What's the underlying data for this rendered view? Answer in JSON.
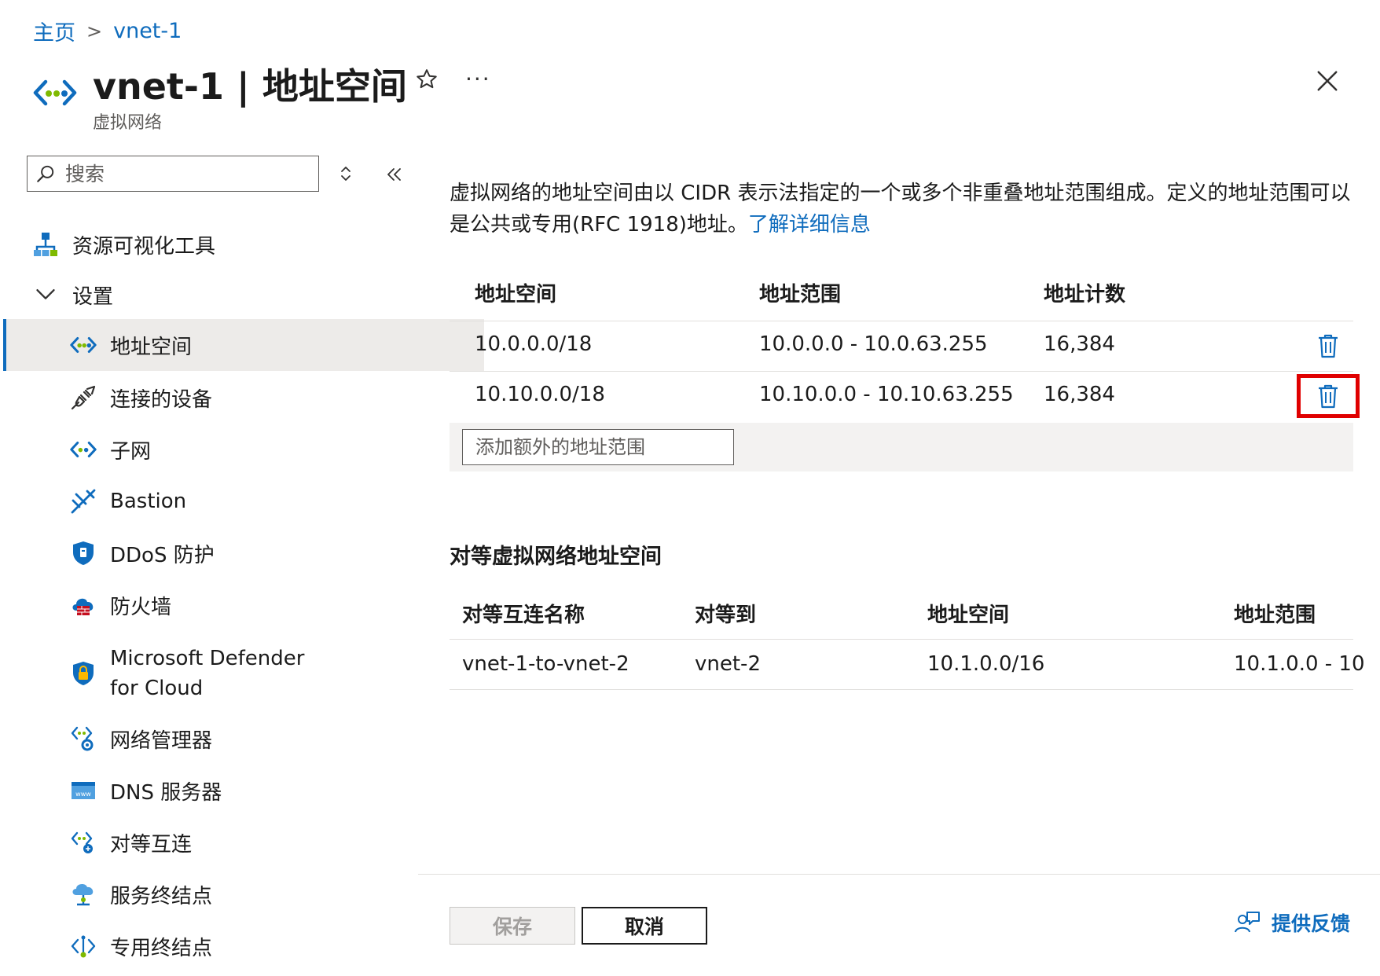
{
  "breadcrumb": {
    "home": "主页",
    "separator": ">",
    "current": "vnet-1"
  },
  "header": {
    "title": "vnet-1 | 地址空间",
    "subtitle": "虚拟网络",
    "more": "···"
  },
  "search": {
    "placeholder": "搜索"
  },
  "sidebar": {
    "items": [
      {
        "label": "资源可视化工具",
        "icon": "resource-visualizer-icon"
      },
      {
        "label": "设置",
        "icon": "chevron-down-icon"
      },
      {
        "label": "地址空间",
        "icon": "vnet-icon",
        "active": true
      },
      {
        "label": "连接的设备",
        "icon": "plug-icon"
      },
      {
        "label": "子网",
        "icon": "subnet-icon"
      },
      {
        "label": "Bastion",
        "icon": "bastion-icon"
      },
      {
        "label": "DDoS 防护",
        "icon": "ddos-shield-icon"
      },
      {
        "label_line1": "Microsoft Defender",
        "label_line2": "for Cloud",
        "icon": "defender-shield-icon"
      },
      {
        "label": "防火墙",
        "icon": "firewall-icon"
      },
      {
        "label": "网络管理器",
        "icon": "network-manager-icon"
      },
      {
        "label": "DNS 服务器",
        "icon": "dns-icon"
      },
      {
        "label": "对等互连",
        "icon": "peering-icon"
      },
      {
        "label": "服务终结点",
        "icon": "service-endpoint-icon"
      },
      {
        "label": "专用终结点",
        "icon": "private-endpoint-icon"
      }
    ]
  },
  "description": {
    "text": "虚拟网络的地址空间由以 CIDR 表示法指定的一个或多个非重叠地址范围组成。定义的地址范围可以是公共或专用(RFC 1918)地址。",
    "link": "了解详细信息"
  },
  "address_table": {
    "headers": [
      "地址空间",
      "地址范围",
      "地址计数"
    ],
    "rows": [
      {
        "space": "10.0.0.0/18",
        "range": "10.0.0.0 - 10.0.63.255",
        "count": "16,384"
      },
      {
        "space": "10.10.0.0/18",
        "range": "10.10.0.0 - 10.10.63.255",
        "count": "16,384"
      }
    ],
    "add_placeholder": "添加额外的地址范围"
  },
  "peer_section": {
    "title": "对等虚拟网络地址空间",
    "headers": [
      "对等互连名称",
      "对等到",
      "地址空间",
      "地址范围"
    ],
    "rows": [
      {
        "name": "vnet-1-to-vnet-2",
        "peer": "vnet-2",
        "space": "10.1.0.0/16",
        "range": "10.1.0.0 - 10"
      }
    ]
  },
  "footer": {
    "save": "保存",
    "cancel": "取消",
    "feedback": "提供反馈"
  },
  "colors": {
    "accent": "#0f6cbd",
    "highlight": "#e00000",
    "active_bg": "#edebe9"
  }
}
